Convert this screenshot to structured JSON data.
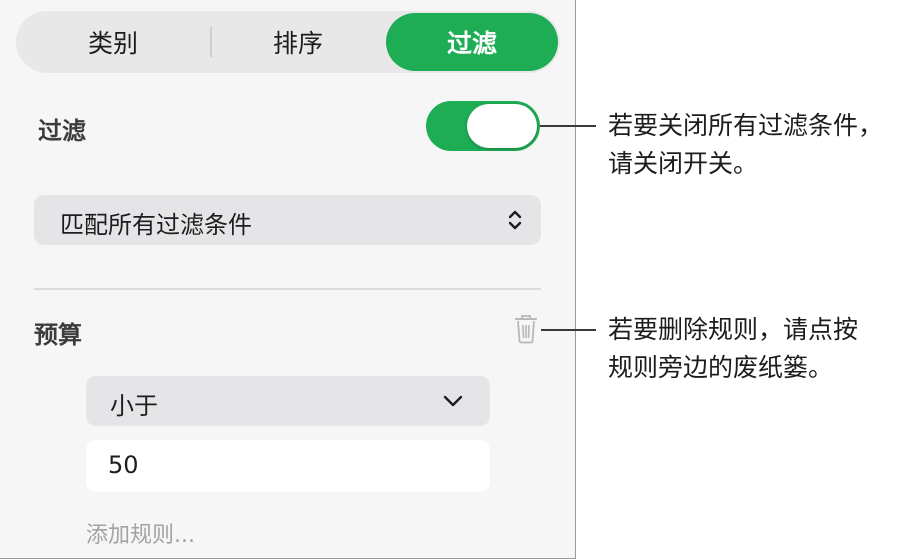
{
  "tabs": [
    {
      "label": "类别",
      "active": false
    },
    {
      "label": "排序",
      "active": false
    },
    {
      "label": "过滤",
      "active": true
    }
  ],
  "filter": {
    "label": "过滤",
    "toggle_on": true
  },
  "match_select": {
    "value": "匹配所有过滤条件",
    "icon": "chevron-updown-icon"
  },
  "rule": {
    "field_label": "预算",
    "delete_icon": "trash-icon",
    "operator": "小于",
    "operator_icon": "chevron-down-icon",
    "value": "50"
  },
  "add_rule_label": "添加规则...",
  "callouts": {
    "toggle": [
      "若要关闭所有过滤条件，",
      "请关闭开关。"
    ],
    "trash": [
      "若要删除规则，请点按",
      "规则旁边的废纸篓。"
    ]
  },
  "colors": {
    "accent": "#1eac55",
    "panel_bg": "#f6f6f6",
    "control_bg": "#e5e5e7"
  }
}
